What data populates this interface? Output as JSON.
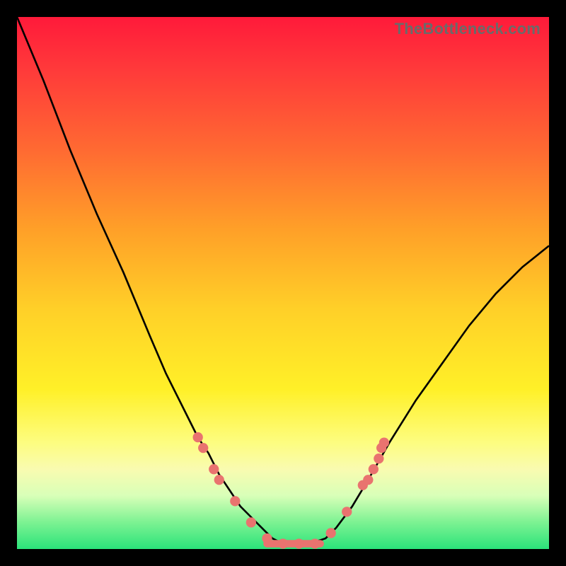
{
  "watermark": "TheBottleneck.com",
  "chart_data": {
    "type": "line",
    "title": "",
    "xlabel": "",
    "ylabel": "",
    "xlim": [
      0,
      100
    ],
    "ylim": [
      0,
      100
    ],
    "note": "Axes are unlabeled in the image; values below are pixel-position estimates on a 0–100 normalized scale (read from geometry, not from printed tick labels).",
    "series": [
      {
        "name": "performance-curve",
        "x": [
          0,
          5,
          10,
          15,
          20,
          25,
          28,
          30,
          32,
          34,
          36,
          38,
          40,
          42,
          44,
          46,
          48,
          50,
          52,
          55,
          58,
          60,
          63,
          66,
          70,
          75,
          80,
          85,
          90,
          95,
          100
        ],
        "values": [
          100,
          88,
          75,
          63,
          52,
          40,
          33,
          29,
          25,
          21,
          18,
          14,
          11,
          8,
          6,
          4,
          2,
          1,
          1,
          1,
          2,
          4,
          8,
          13,
          20,
          28,
          35,
          42,
          48,
          53,
          57
        ]
      }
    ],
    "markers": [
      {
        "x": 34,
        "y": 21
      },
      {
        "x": 35,
        "y": 19
      },
      {
        "x": 37,
        "y": 15
      },
      {
        "x": 38,
        "y": 13
      },
      {
        "x": 41,
        "y": 9
      },
      {
        "x": 44,
        "y": 5
      },
      {
        "x": 47,
        "y": 2
      },
      {
        "x": 50,
        "y": 1
      },
      {
        "x": 53,
        "y": 1
      },
      {
        "x": 56,
        "y": 1
      },
      {
        "x": 59,
        "y": 3
      },
      {
        "x": 62,
        "y": 7
      },
      {
        "x": 65,
        "y": 12
      },
      {
        "x": 66,
        "y": 13
      },
      {
        "x": 67,
        "y": 15
      },
      {
        "x": 68,
        "y": 17
      },
      {
        "x": 68.5,
        "y": 19
      },
      {
        "x": 69,
        "y": 20
      }
    ],
    "flat_segment": {
      "x0": 47,
      "x1": 57,
      "y": 1
    },
    "colors": {
      "curve": "#000000",
      "marker": "#e9736f",
      "flat_segment": "#e9736f"
    }
  }
}
